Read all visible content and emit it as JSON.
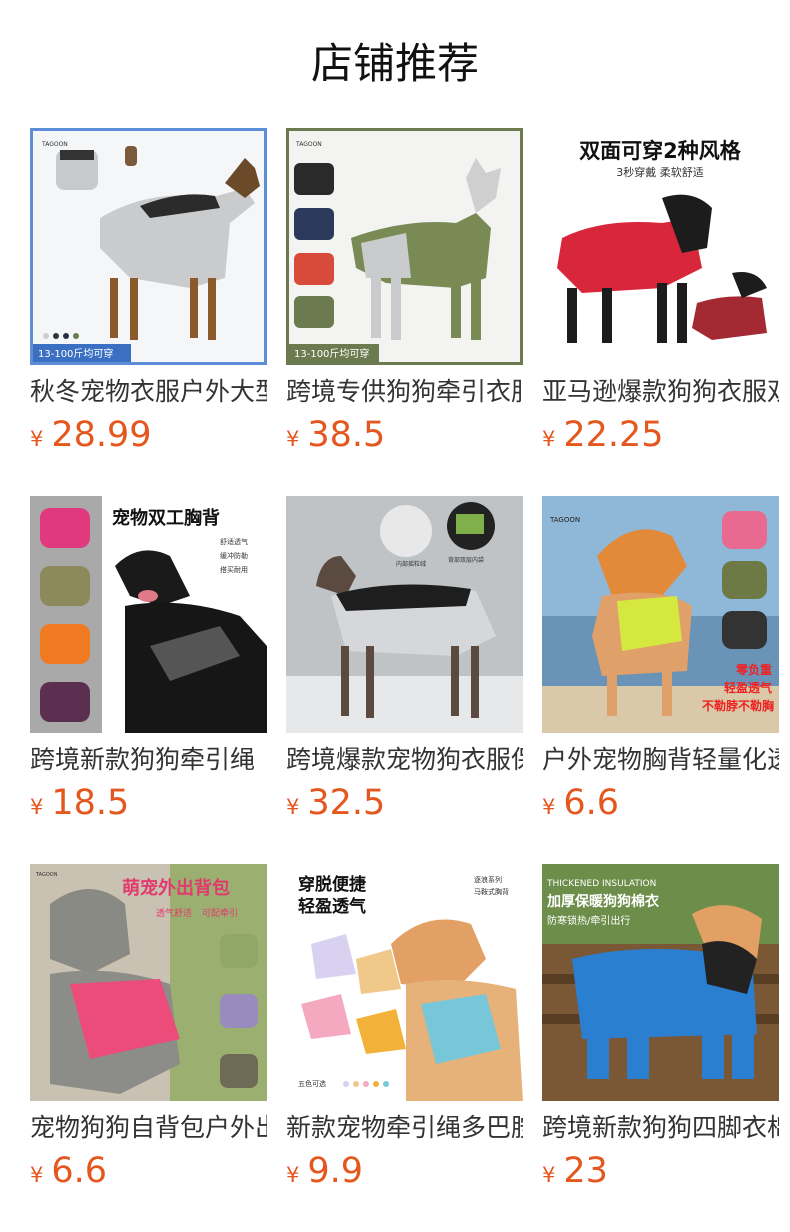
{
  "page": {
    "title": "店铺推荐"
  },
  "products": [
    {
      "name": "秋冬宠物衣服户外大型犬保暖外套",
      "currency": "¥",
      "price": "28.99",
      "image": "gray-black-dog-coat",
      "img_text": [
        "13-100斤均可穿"
      ],
      "brand": "TAGOON"
    },
    {
      "name": "跨境专供狗狗牵引衣服四脚衣",
      "currency": "¥",
      "price": "38.5",
      "image": "green-gray-dog-suit",
      "img_text": [
        "13-100斤均可穿"
      ],
      "brand": "TAGOON"
    },
    {
      "name": "亚马逊爆款狗狗衣服双面可穿",
      "currency": "¥",
      "price": "22.25",
      "image": "red-reversible-vest",
      "img_text": [
        "双面可穿2种风格",
        "3秒穿戴 柔软舒适"
      ]
    },
    {
      "name": "跨境新款狗狗牵引绳",
      "currency": "¥",
      "price": "18.5",
      "image": "rottweiler-harness",
      "img_text": [
        "宠物双工胸背",
        "舒适透气",
        "缓冲防勒",
        "搭买耐用"
      ]
    },
    {
      "name": "跨境爆款宠物狗衣服保暖",
      "currency": "¥",
      "price": "32.5",
      "image": "snow-dog-coat",
      "img_text": [
        "内部摇粒绒",
        "背部双层内袋"
      ]
    },
    {
      "name": "户外宠物胸背轻量化透气",
      "currency": "¥",
      "price": "6.6",
      "image": "shiba-beach-harness",
      "img_text": [
        "零负重",
        "轻盈透气",
        "不勒脖不勒胸"
      ],
      "brand": "TAGOON"
    },
    {
      "name": "宠物狗狗自背包户外出行",
      "currency": "¥",
      "price": "6.6",
      "image": "pink-backpack-harness",
      "img_text": [
        "萌宠外出背包",
        "透气舒适",
        "可配牵引"
      ],
      "brand": "TAGOON"
    },
    {
      "name": "新款宠物牵引绳多巴胺胸背",
      "currency": "¥",
      "price": "9.9",
      "image": "pastel-harness-set",
      "img_text": [
        "穿脱便捷",
        "轻盈透气",
        "逐浪系列",
        "马鞍式胸背",
        "五色可选"
      ]
    },
    {
      "name": "跨境新款狗狗四脚衣棉衣",
      "currency": "¥",
      "price": "23",
      "image": "blue-padded-coat",
      "img_text": [
        "THICKENED INSULATION",
        "加厚保暖狗狗棉衣",
        "防寒锁热/牵引出行"
      ]
    }
  ]
}
